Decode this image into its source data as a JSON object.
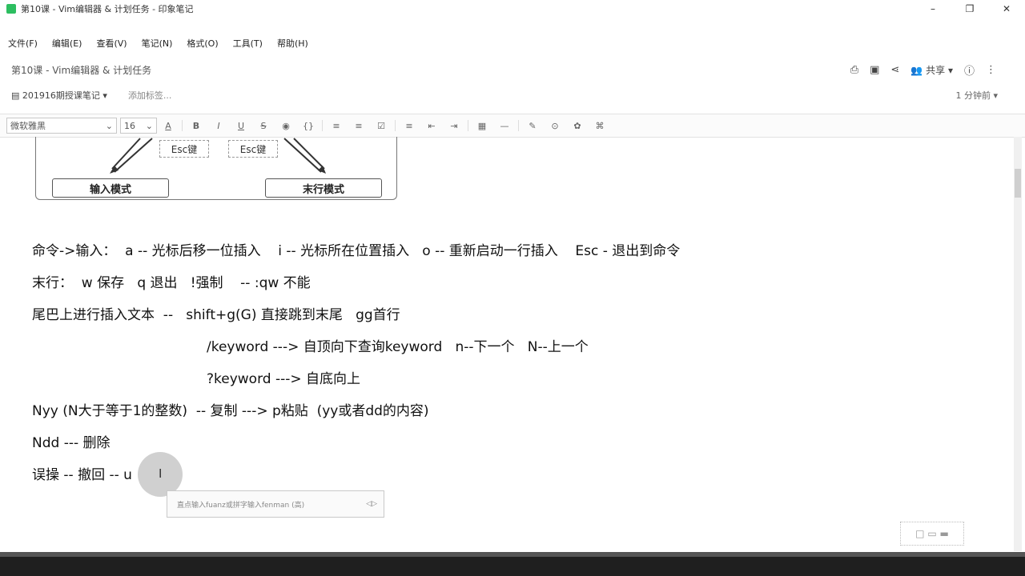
{
  "window": {
    "title": "第10课 - Vim编辑器 & 计划任务 - 印象笔记",
    "controls": [
      "–",
      "❐",
      "✕"
    ]
  },
  "menu": [
    "文件(F)",
    "编辑(E)",
    "查看(V)",
    "笔记(N)",
    "格式(O)",
    "工具(T)",
    "帮助(H)"
  ],
  "note": {
    "title": "第10课 - Vim编辑器 & 计划任务",
    "share_label": "共享",
    "notebook": "201916期授课笔记",
    "add_tag": "添加标签...",
    "reading_time": "1 分钟前"
  },
  "toolbar": {
    "font": "微软雅黑",
    "size": "16",
    "buttons": [
      "A",
      "B",
      "I",
      "U",
      "S",
      "◉",
      "{}",
      "≡",
      "≡",
      "☑",
      "≡",
      "⇤",
      "⇥",
      "▦",
      "—",
      "✎",
      "⊙",
      "✿",
      "⌘"
    ]
  },
  "diagram": {
    "esc_left": "Esc键",
    "esc_right": "Esc键",
    "mode_input": "输入模式",
    "mode_lastline": "末行模式"
  },
  "lines": {
    "l1": "命令->输入：  a -- 光标后移一位插入    i -- 光标所在位置插入   o -- 重新启动一行插入    Esc - 退出到命令",
    "l2": "末行：  w 保存   q 退出   !强制    -- :qw 不能",
    "l3": "尾巴上进行插入文本  --   shift+g(G) 直接跳到末尾   gg首行",
    "l4": "/keyword ---> 自顶向下查询keyword   n--下一个   N--上一个",
    "l5": "?keyword ---> 自底向上",
    "l6": "Nyy (N大于等于1的整数)  -- 复制 ---> p粘贴  (yy或者dd的内容)",
    "l7": "Ndd --- 删除",
    "l8": "误操 -- 撤回 -- u"
  },
  "ime": {
    "hint": "直点输入fuanz或拼字输入fenman (高)"
  },
  "colors": {
    "app_green": "#2dbe60",
    "taskbar": "#1f1f1f"
  }
}
